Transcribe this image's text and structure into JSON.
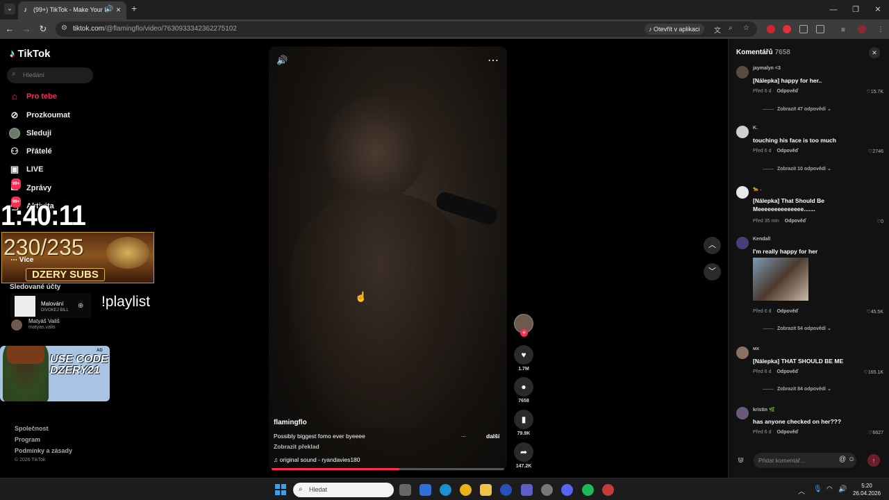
{
  "browser": {
    "tab_title": "(99+) TikTok - Make Your Day",
    "url_host": "tiktok.com",
    "url_path": "/@flamingflo/video/7630933342362275102",
    "open_in_app": "Otevřít v aplikaci"
  },
  "sidebar": {
    "logo": "TikTok",
    "search_placeholder": "Hledání",
    "nav": [
      {
        "label": "Pro tebe",
        "icon": "home-icon",
        "active": true
      },
      {
        "label": "Prozkoumat",
        "icon": "compass-icon"
      },
      {
        "label": "Sleduji",
        "icon": "avatar-icon"
      },
      {
        "label": "Přátelé",
        "icon": "friends-icon"
      },
      {
        "label": "LIVE",
        "icon": "live-icon"
      },
      {
        "label": "Zprávy",
        "icon": "messages-icon",
        "badge": "99+"
      },
      {
        "label": "Aktivita",
        "icon": "activity-icon",
        "badge": "99+"
      }
    ],
    "more_label": "Více",
    "followed_header": "Sledované účty",
    "accounts": [
      {
        "name": "Matyáš Vališ",
        "username": "matyas.valis"
      }
    ],
    "footer": [
      "Společnost",
      "Program",
      "Podmínky a zásady"
    ],
    "copyright": "© 2026 TikTok"
  },
  "overlays": {
    "timer": "1:40:11",
    "subs_count": "230/235",
    "subs_label": "DZERY SUBS",
    "playlist_title": "Malování",
    "playlist_artist": "DIVOKEJ BILL",
    "playlist_command": "!playlist",
    "promo_text": "USE CODE DZERY21",
    "promo_ad": "AD"
  },
  "video": {
    "author": "flamingflo",
    "caption": "Possibly biggest fomo ever byeeee",
    "ellipsis": "...",
    "more": "další",
    "translate": "Zobrazit překlad",
    "sound": "original sound - ryandavies180",
    "progress": 0.55
  },
  "actions": {
    "likes": "1.7M",
    "comments": "7658",
    "saves": "79.9K",
    "shares": "147.2K"
  },
  "comments": {
    "title": "Komentářů",
    "count": "7658",
    "reply_label": "Odpověď",
    "input_placeholder": "Přidat komentář...",
    "items": [
      {
        "user": "jaymalyn <3",
        "text": "[Nálepka] happy for her..",
        "time": "Před 6 d",
        "likes": "15.7K",
        "more": "Zobrazit 47 odpovědí"
      },
      {
        "user": "K.",
        "text": "touching his face is too much",
        "time": "Před 6 d",
        "likes": "2746",
        "more": "Zobrazit 10 odpovědí"
      },
      {
        "user": "🐆 .",
        "text": "[Nálepka] That Should Be Meeeeeeeeeeeeee.......",
        "time": "Před 35 min",
        "likes": "0"
      },
      {
        "user": "Kendall",
        "text": "I'm really happy for her",
        "time": "Před 6 d",
        "likes": "45.5K",
        "more": "Zobrazit 54 odpovědí"
      },
      {
        "user": "мх",
        "text": "[Nálepka] THAT SHOULD BE ME",
        "time": "Před 6 d",
        "likes": "165.1K",
        "more": "Zobrazit 84 odpovědí"
      },
      {
        "user": "kristin 🌿",
        "text": "has anyone checked on her???",
        "time": "Před 6 d",
        "likes": "6627"
      }
    ]
  },
  "taskbar": {
    "search_placeholder": "Hledat",
    "time": "5:20",
    "date": "26.04.2026"
  }
}
